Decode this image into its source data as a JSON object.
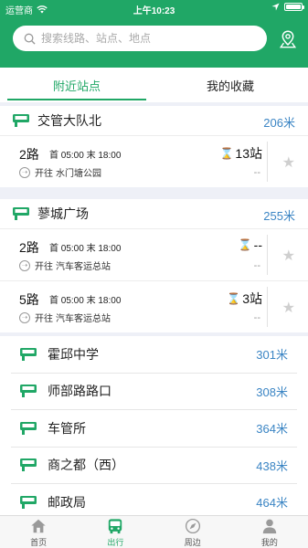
{
  "status_bar": {
    "carrier": "运营商",
    "time": "上午10:23"
  },
  "search": {
    "placeholder": "搜索线路、站点、地点"
  },
  "tabs": [
    {
      "label": "附近站点",
      "active": true
    },
    {
      "label": "我的收藏",
      "active": false
    }
  ],
  "stations": [
    {
      "name": "交管大队北",
      "distance": "206米",
      "routes": [
        {
          "name": "2路",
          "times": "首 05:00  末 18:00",
          "direction_prefix": "开往",
          "direction": "水门塘公园",
          "arrival": "13站",
          "sub": "--"
        }
      ]
    },
    {
      "name": "蓼城广场",
      "distance": "255米",
      "routes": [
        {
          "name": "2路",
          "times": "首 05:00  末 18:00",
          "direction_prefix": "开往",
          "direction": "汽车客运总站",
          "arrival": "--",
          "sub": "--"
        },
        {
          "name": "5路",
          "times": "首 05:00  末 18:00",
          "direction_prefix": "开往",
          "direction": "汽车客运总站",
          "arrival": "3站",
          "sub": "--"
        }
      ]
    }
  ],
  "nearby_list": [
    {
      "name": "霍邱中学",
      "distance": "301米"
    },
    {
      "name": "师部路路口",
      "distance": "308米"
    },
    {
      "name": "车管所",
      "distance": "364米"
    },
    {
      "name": "商之都（西）",
      "distance": "438米"
    },
    {
      "name": "邮政局",
      "distance": "464米"
    }
  ],
  "tabbar": [
    {
      "label": "首页",
      "icon": "home-icon",
      "active": false
    },
    {
      "label": "出行",
      "icon": "bus-icon",
      "active": true
    },
    {
      "label": "周边",
      "icon": "compass-icon",
      "active": false
    },
    {
      "label": "我的",
      "icon": "person-icon",
      "active": false
    }
  ],
  "colors": {
    "brand": "#20a766",
    "distance": "#3b85c4",
    "background": "#eef0f7"
  }
}
